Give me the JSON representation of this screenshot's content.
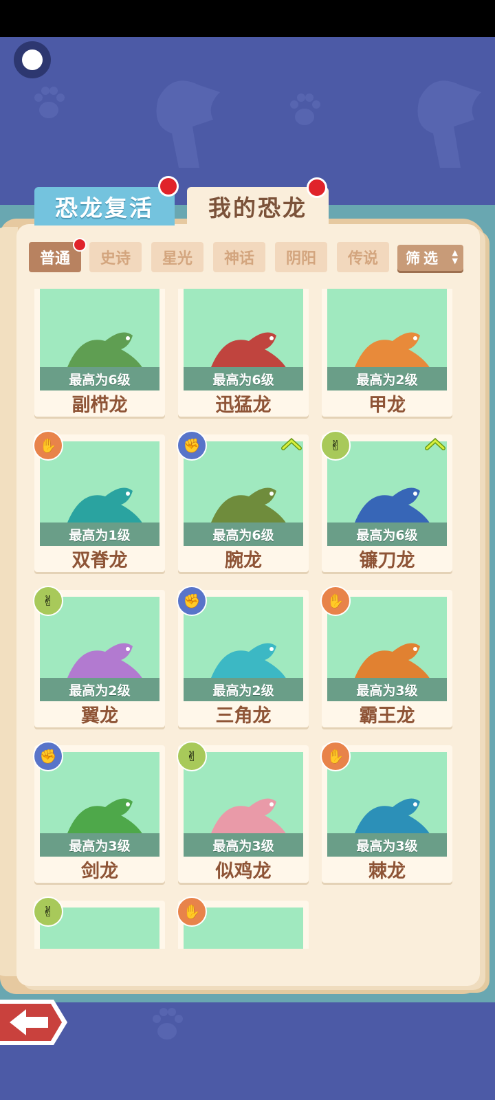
{
  "tabs": [
    {
      "label": "恐龙复活"
    },
    {
      "label": "我的恐龙"
    }
  ],
  "filters": [
    "普通",
    "史诗",
    "星光",
    "神话",
    "阴阳",
    "传说"
  ],
  "filter_button": "筛选",
  "cards": [
    {
      "name": "副栉龙",
      "level": "最高为6级",
      "badge": "",
      "upgrade": false
    },
    {
      "name": "迅猛龙",
      "level": "最高为6级",
      "badge": "",
      "upgrade": false
    },
    {
      "name": "甲龙",
      "level": "最高为2级",
      "badge": "",
      "upgrade": false
    },
    {
      "name": "双脊龙",
      "level": "最高为1级",
      "badge": "orange",
      "upgrade": false
    },
    {
      "name": "腕龙",
      "level": "最高为6级",
      "badge": "blue",
      "upgrade": true
    },
    {
      "name": "镰刀龙",
      "level": "最高为6级",
      "badge": "green",
      "upgrade": true
    },
    {
      "name": "翼龙",
      "level": "最高为2级",
      "badge": "green",
      "upgrade": false
    },
    {
      "name": "三角龙",
      "level": "最高为2级",
      "badge": "blue",
      "upgrade": false
    },
    {
      "name": "霸王龙",
      "level": "最高为3级",
      "badge": "orange",
      "upgrade": false
    },
    {
      "name": "剑龙",
      "level": "最高为3级",
      "badge": "blue",
      "upgrade": false
    },
    {
      "name": "似鸡龙",
      "level": "最高为3级",
      "badge": "green",
      "upgrade": false
    },
    {
      "name": "棘龙",
      "level": "最高为3级",
      "badge": "orange",
      "upgrade": false
    },
    {
      "name": "",
      "level": "",
      "badge": "green",
      "upgrade": false
    },
    {
      "name": "",
      "level": "",
      "badge": "orange",
      "upgrade": false
    }
  ]
}
